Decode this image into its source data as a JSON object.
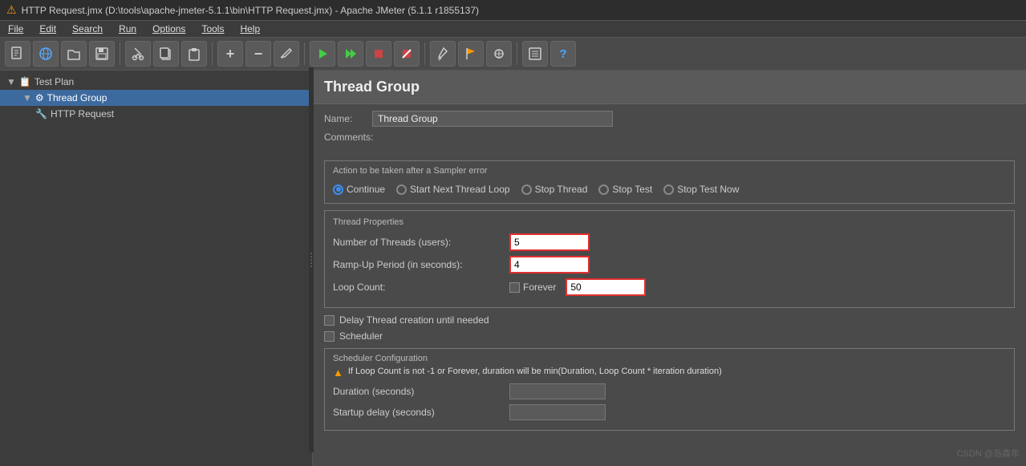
{
  "titlebar": {
    "icon": "⚠",
    "text": "HTTP Request.jmx (D:\\tools\\apache-jmeter-5.1.1\\bin\\HTTP Request.jmx) - Apache JMeter (5.1.1 r1855137)"
  },
  "menubar": {
    "items": [
      "File",
      "Edit",
      "Search",
      "Run",
      "Options",
      "Tools",
      "Help"
    ]
  },
  "toolbar": {
    "buttons": [
      "📄",
      "🌐",
      "📁",
      "💾",
      "✂",
      "📋",
      "📄",
      "➕",
      "➖",
      "✏",
      "▶",
      "▶▶",
      "⏹",
      "⏹",
      "🔧",
      "🔧",
      "🐛",
      "🏴",
      "📋",
      "❓"
    ]
  },
  "tree": {
    "items": [
      {
        "label": "Test Plan",
        "level": 0,
        "icon": "📋",
        "selected": false
      },
      {
        "label": "Thread Group",
        "level": 1,
        "icon": "⚙",
        "selected": true
      },
      {
        "label": "HTTP Request",
        "level": 2,
        "icon": "🔧",
        "selected": false
      }
    ]
  },
  "content": {
    "title": "Thread Group",
    "name_label": "Name:",
    "name_value": "Thread Group",
    "comments_label": "Comments:",
    "action_section_title": "Action to be taken after a Sampler error",
    "radio_options": [
      {
        "label": "Continue",
        "selected": true
      },
      {
        "label": "Start Next Thread Loop",
        "selected": false
      },
      {
        "label": "Stop Thread",
        "selected": false
      },
      {
        "label": "Stop Test",
        "selected": false
      },
      {
        "label": "Stop Test Now",
        "selected": false
      }
    ],
    "props_title": "Thread Properties",
    "props": [
      {
        "label": "Number of Threads (users):",
        "value": "5"
      },
      {
        "label": "Ramp-Up Period (in seconds):",
        "value": "4"
      },
      {
        "label": "Loop Count:",
        "value": "50",
        "has_forever": true
      }
    ],
    "delay_thread_label": "Delay Thread creation until needed",
    "scheduler_label": "Scheduler",
    "scheduler_config_title": "Scheduler Configuration",
    "scheduler_warning": "If Loop Count is not -1 or Forever, duration will be min(Duration, Loop Count * iteration duration)",
    "duration_label": "Duration (seconds)",
    "startup_delay_label": "Startup delay (seconds)"
  },
  "watermark": "CSDN @岛森年"
}
